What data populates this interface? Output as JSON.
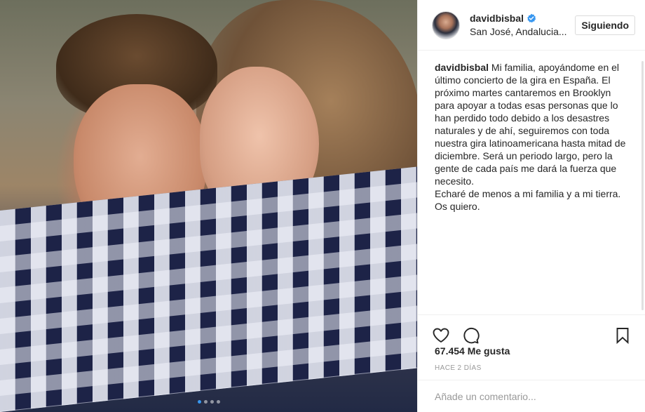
{
  "post": {
    "username": "davidbisbal",
    "location": "San José, Andalucia...",
    "follow_label": "Siguiendo",
    "caption_text": "Mi familia, apoyándome en el último concierto de la gira en España. El próximo martes cantaremos en Brooklyn para apoyar a todas esas personas que lo han perdido todo debido a los desastres naturales y de ahí, seguiremos con toda nuestra gira latinoamericana hasta mitad de diciembre. Será un periodo largo, pero la gente de cada país me dará la fuerza que necesito.\nEcharé de menos a mi familia y a mi tierra.\nOs quiero.",
    "likes": "67.454 Me gusta",
    "time": "HACE 2 DÍAS",
    "comment_placeholder": "Añade un comentario..."
  },
  "carousel": {
    "slide_count": 4,
    "active_index": 0
  },
  "icons": {
    "verified": "verified-badge-icon",
    "like": "heart-icon",
    "comment": "comment-bubble-icon",
    "save": "bookmark-icon"
  },
  "colors": {
    "verified": "#3897f0",
    "border": "#efefef",
    "text": "#262626",
    "muted": "#999999"
  }
}
